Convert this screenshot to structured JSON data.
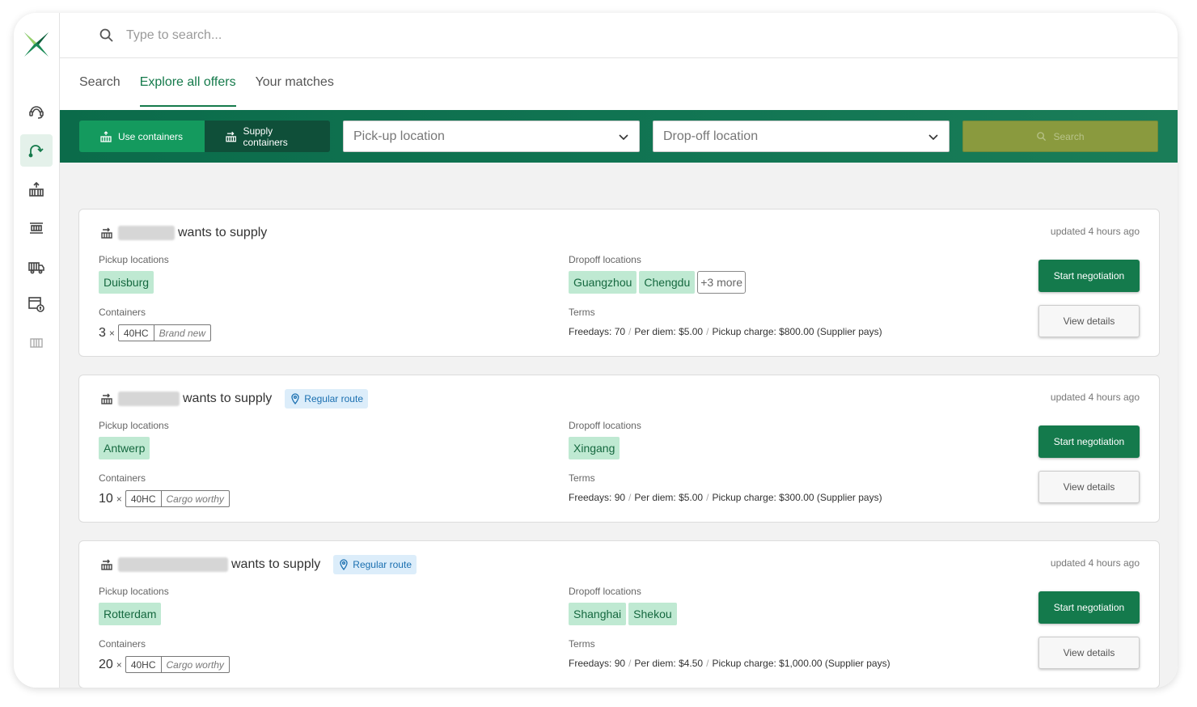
{
  "search": {
    "placeholder": "Type to search..."
  },
  "tabs": [
    {
      "label": "Search",
      "active": false
    },
    {
      "label": "Explore all offers",
      "active": true
    },
    {
      "label": "Your matches",
      "active": false
    }
  ],
  "filters": {
    "use_containers": "Use containers",
    "supply_containers": "Supply containers",
    "pickup_placeholder": "Pick-up location",
    "dropoff_placeholder": "Drop-off location",
    "search_button": "Search"
  },
  "sidebar": {
    "items": [
      {
        "icon": "support-icon",
        "active": false
      },
      {
        "icon": "route-icon",
        "active": true
      },
      {
        "icon": "use-containers-icon",
        "active": false
      },
      {
        "icon": "container-icon",
        "active": false
      },
      {
        "icon": "truck-icon",
        "active": false
      },
      {
        "icon": "billing-icon",
        "active": false
      },
      {
        "icon": "building-icon",
        "active": false
      }
    ]
  },
  "offers": [
    {
      "supply_text": "wants to supply",
      "regular_route": "",
      "updated": "updated 4 hours ago",
      "pickup_label": "Pickup locations",
      "pickup": [
        "Duisburg"
      ],
      "dropoff_label": "Dropoff locations",
      "dropoff": [
        "Guangzhou",
        "Chengdu"
      ],
      "dropoff_more": "+3 more",
      "containers_label": "Containers",
      "count": "3",
      "times": "×",
      "size": "40HC",
      "condition": "Brand new",
      "terms_label": "Terms",
      "freedays": "Freedays: 70",
      "per_diem": "Per diem: $5.00",
      "pickup_charge": "Pickup charge: $800.00 (Supplier pays)",
      "start": "Start negotiation",
      "view": "View details"
    },
    {
      "supply_text": "wants to supply",
      "regular_route": "Regular route",
      "updated": "updated 4 hours ago",
      "pickup_label": "Pickup locations",
      "pickup": [
        "Antwerp"
      ],
      "dropoff_label": "Dropoff locations",
      "dropoff": [
        "Xingang"
      ],
      "dropoff_more": "",
      "containers_label": "Containers",
      "count": "10",
      "times": "×",
      "size": "40HC",
      "condition": "Cargo worthy",
      "terms_label": "Terms",
      "freedays": "Freedays: 90",
      "per_diem": "Per diem: $5.00",
      "pickup_charge": "Pickup charge: $300.00 (Supplier pays)",
      "start": "Start negotiation",
      "view": "View details"
    },
    {
      "supply_text": "wants to supply",
      "regular_route": "Regular route",
      "updated": "updated 4 hours ago",
      "pickup_label": "Pickup locations",
      "pickup": [
        "Rotterdam"
      ],
      "dropoff_label": "Dropoff locations",
      "dropoff": [
        "Shanghai",
        "Shekou"
      ],
      "dropoff_more": "",
      "containers_label": "Containers",
      "count": "20",
      "times": "×",
      "size": "40HC",
      "condition": "Cargo worthy",
      "terms_label": "Terms",
      "freedays": "Freedays: 90",
      "per_diem": "Per diem: $4.50",
      "pickup_charge": "Pickup charge: $1,000.00 (Supplier pays)",
      "start": "Start negotiation",
      "view": "View details"
    }
  ],
  "colors": {
    "brand_green": "#147a4c",
    "chip_bg": "#bfe9d2",
    "route_badge_bg": "#dcedfa",
    "search_button_bg": "#8a9a3e"
  }
}
